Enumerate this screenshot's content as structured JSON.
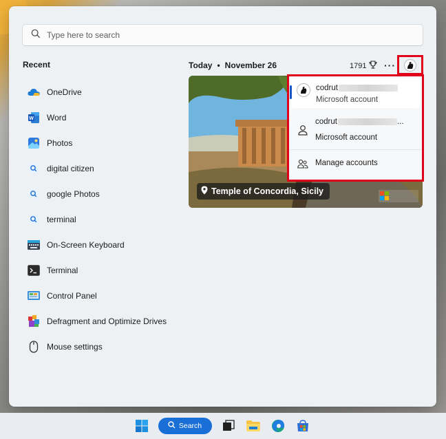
{
  "search": {
    "placeholder": "Type here to search"
  },
  "recent": {
    "title": "Recent",
    "items": [
      {
        "label": "OneDrive",
        "icon": "onedrive-icon"
      },
      {
        "label": "Word",
        "icon": "word-icon"
      },
      {
        "label": "Photos",
        "icon": "photos-icon"
      },
      {
        "label": "digital citizen",
        "icon": "search-result-icon"
      },
      {
        "label": "google Photos",
        "icon": "search-result-icon"
      },
      {
        "label": "terminal",
        "icon": "search-result-icon"
      },
      {
        "label": "On-Screen Keyboard",
        "icon": "keyboard-icon"
      },
      {
        "label": "Terminal",
        "icon": "terminal-icon"
      },
      {
        "label": "Control Panel",
        "icon": "control-panel-icon"
      },
      {
        "label": "Defragment and Optimize Drives",
        "icon": "defrag-icon"
      },
      {
        "label": "Mouse settings",
        "icon": "mouse-icon"
      }
    ]
  },
  "today": {
    "label": "Today",
    "separator": "•",
    "date": "November 26",
    "points": "1791"
  },
  "hero": {
    "caption": "Temple of Concordia, Sicily"
  },
  "accounts": {
    "current": {
      "name": "codrut",
      "type": "Microsoft account"
    },
    "other": {
      "name": "codrut",
      "suffix": "...",
      "type": "Microsoft account"
    },
    "manage_label": "Manage accounts"
  },
  "taskbar": {
    "search_label": "Search"
  },
  "colors": {
    "highlight": "#e1001a",
    "accent": "#1a6fd6"
  }
}
